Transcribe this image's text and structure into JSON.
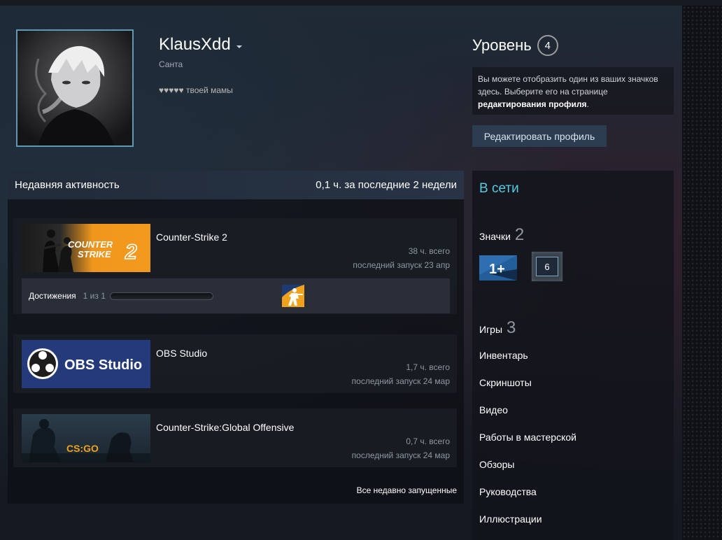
{
  "profile": {
    "persona_name": "KlausXdd",
    "real_name": "Санта",
    "summary": "♥♥♥♥♥ твоей мамы"
  },
  "level": {
    "label": "Уровень",
    "value": "4"
  },
  "badge_hint": {
    "text_before": "Вы можете отобразить один из ваших значков здесь. Выберите его на странице ",
    "link_text": "редактирования профиля",
    "text_after": "."
  },
  "edit_profile_label": "Редактировать профиль",
  "recent_activity": {
    "title": "Недавняя активность",
    "summary": "0,1 ч. за последние 2 недели",
    "view_all": "Все недавно запущенные",
    "games": [
      {
        "name": "Counter-Strike 2",
        "hours": "38 ч. всего",
        "last_played": "последний запуск 23 апр",
        "capsule_text": [
          "COUNTER",
          "STRIKE",
          "2"
        ],
        "achievements": {
          "label": "Достижения",
          "progress_text": "1 из 1"
        }
      },
      {
        "name": "OBS Studio",
        "hours": "1,7 ч. всего",
        "last_played": "последний запуск 24 мар",
        "capsule_text": "OBS Studio"
      },
      {
        "name": "Counter-Strike:Global Offensive",
        "hours": "0,7 ч. всего",
        "last_played": "последний запуск 24 мар",
        "capsule_text": "CS:GO"
      }
    ]
  },
  "sidebar": {
    "status": "В сети",
    "badges": {
      "label": "Значки",
      "count": "2"
    },
    "badge_items": [
      "1+",
      "6"
    ],
    "games": {
      "label": "Игры",
      "count": "3"
    },
    "links": [
      "Инвентарь",
      "Скриншоты",
      "Видео",
      "Работы в мастерской",
      "Обзоры",
      "Руководства",
      "Иллюстрации"
    ]
  },
  "colors": {
    "accent_online": "#57cbde",
    "cs2_orange": "#f0961c",
    "obs_blue": "#243a7a",
    "edit_button": "#2c3d52"
  }
}
